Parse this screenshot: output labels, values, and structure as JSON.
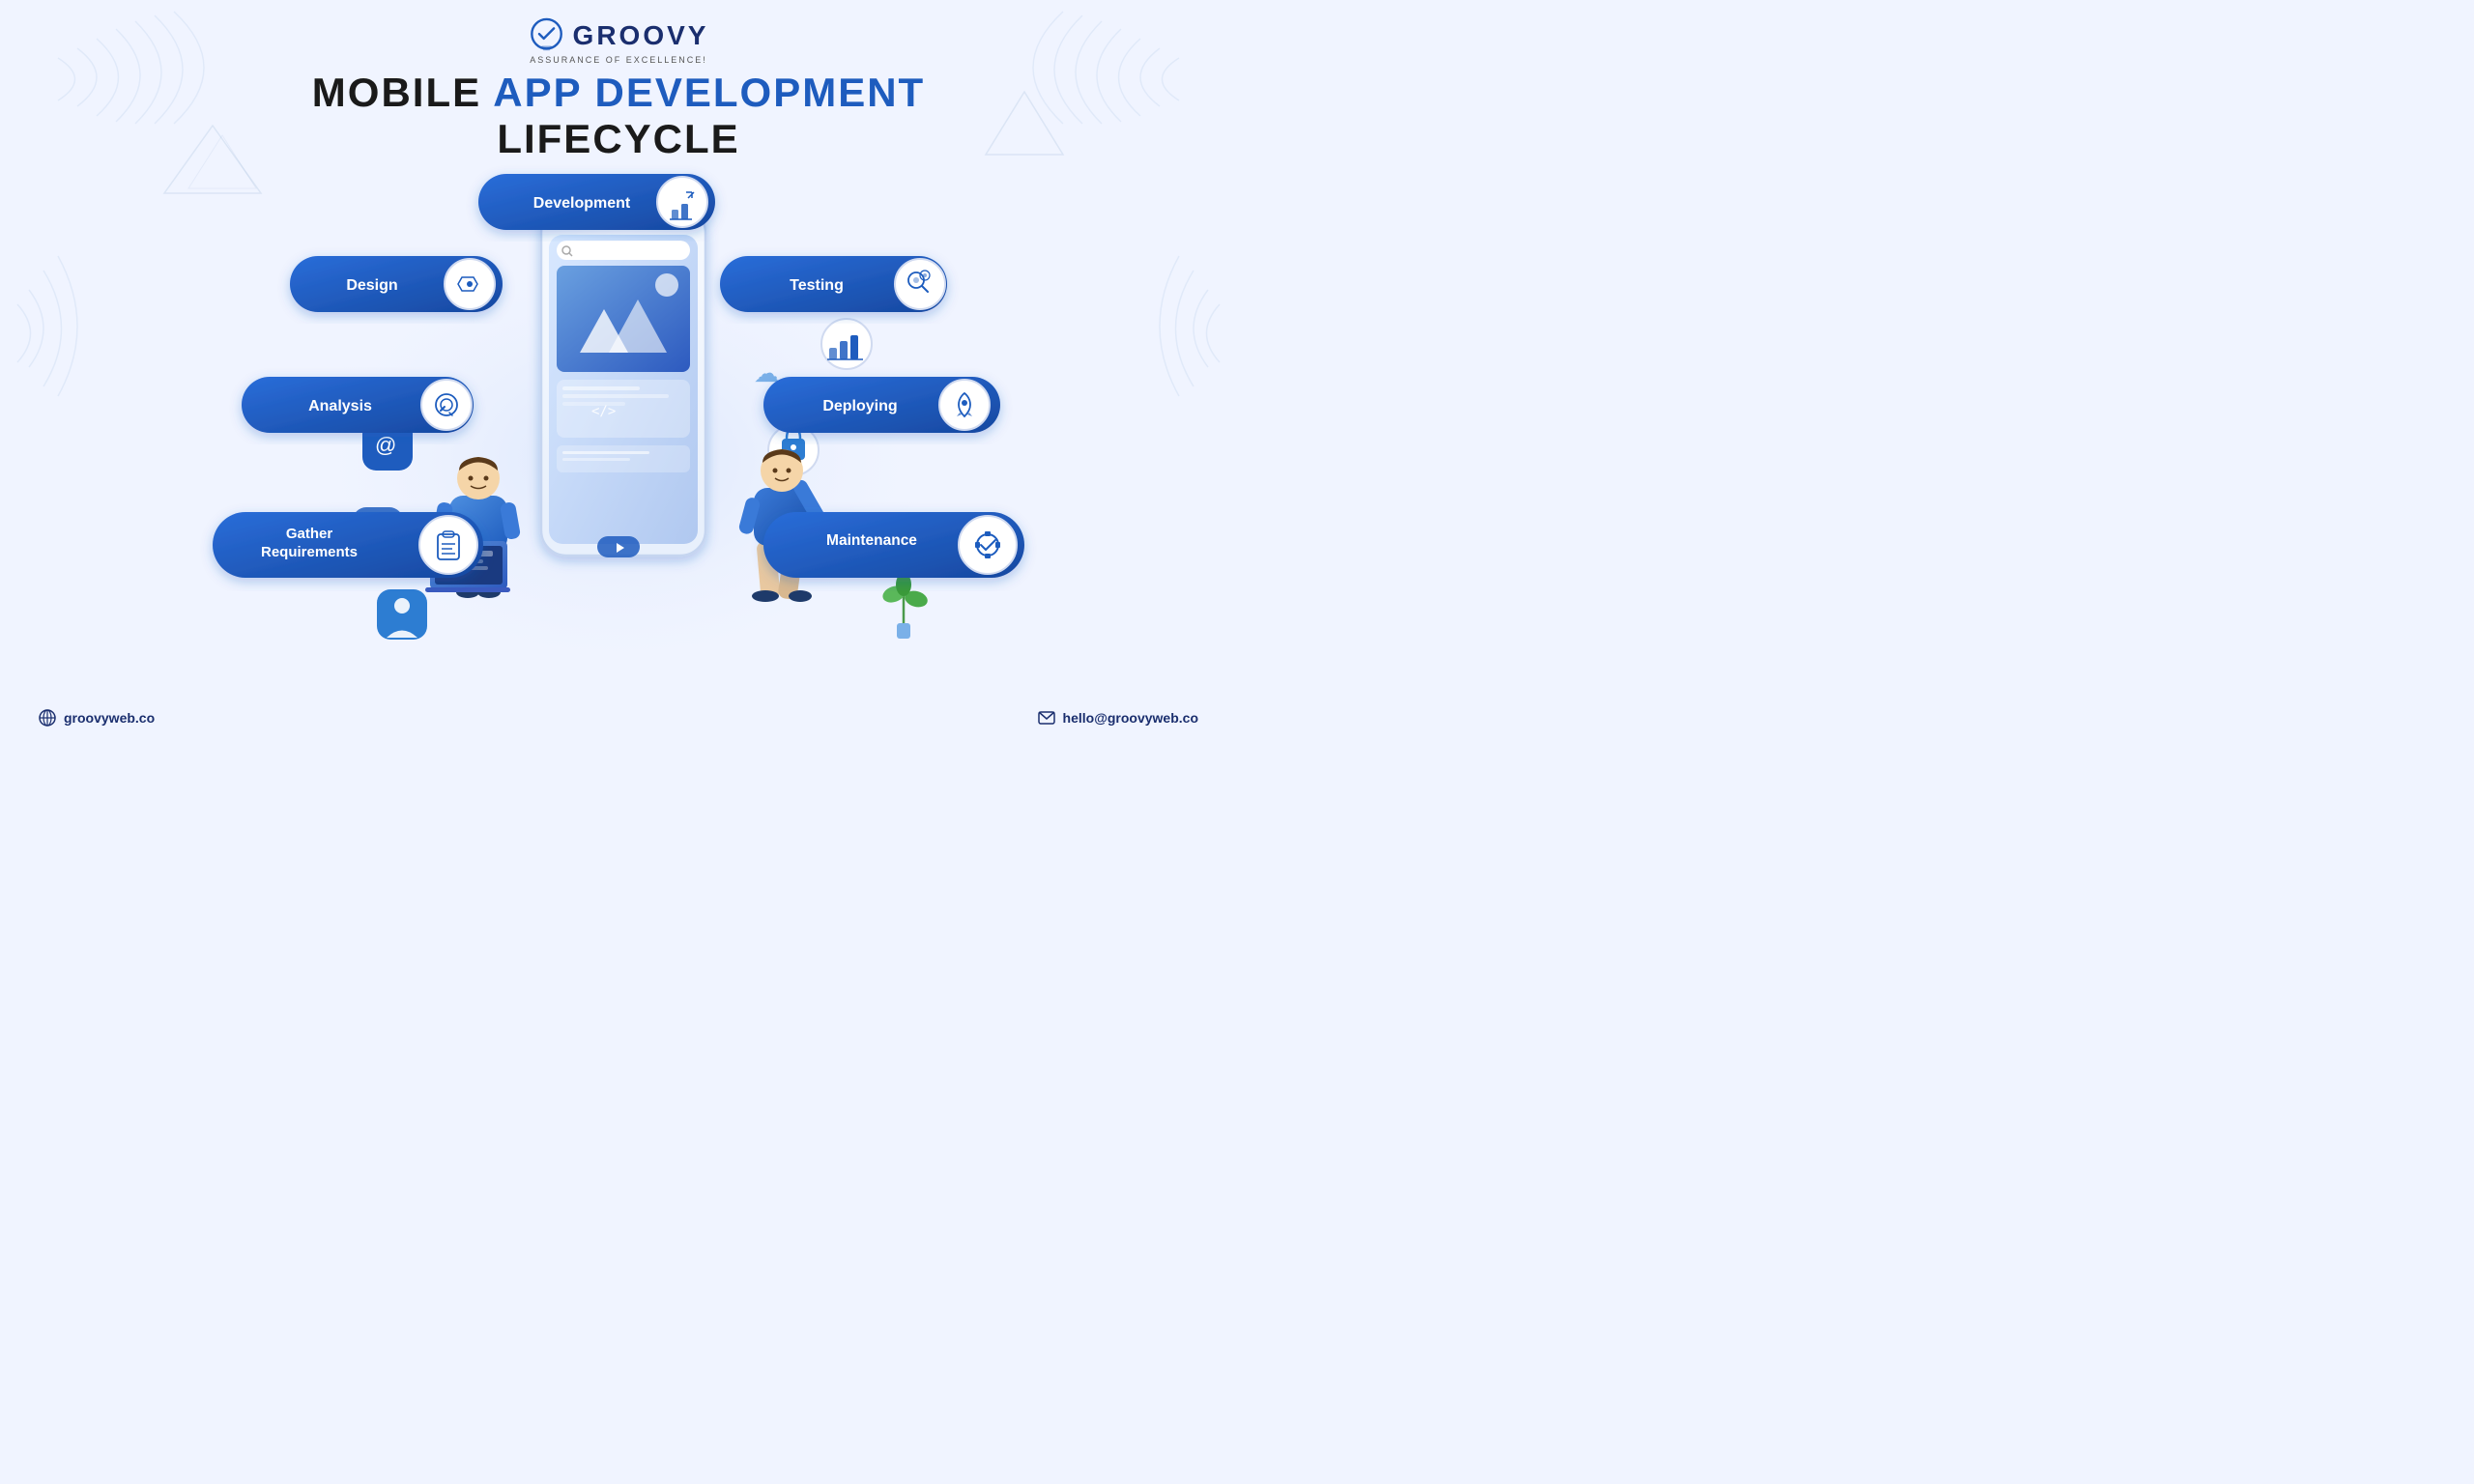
{
  "logo": {
    "name": "GROOVY",
    "tagline": "ASSURANCE OF EXCELLENCE!",
    "icon": "✓"
  },
  "title": {
    "line1_black": "MOBILE",
    "line1_blue": " APP DEVELOPMENT",
    "line2": "LIFECYCLE"
  },
  "stages": {
    "gather": "Gather Requirements",
    "analysis": "Analysis",
    "design": "Design",
    "development": "Development",
    "testing": "Testing",
    "deploying": "Deploying",
    "maintenance": "Maintenance"
  },
  "footer": {
    "website": "groovyweb.co",
    "email": "hello@groovyweb.co"
  }
}
